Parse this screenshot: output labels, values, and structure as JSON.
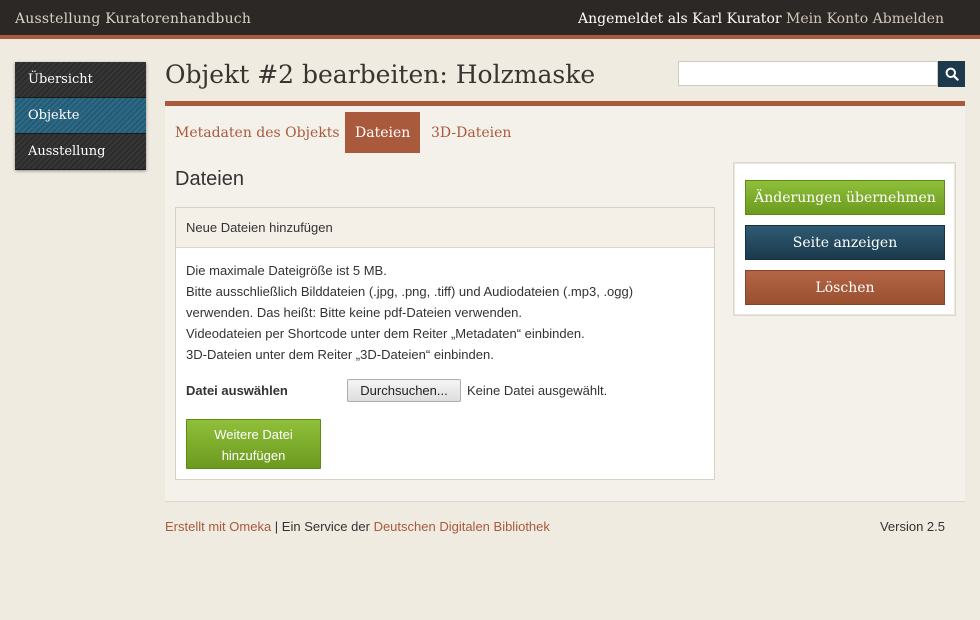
{
  "app": {
    "site_title": "Ausstellung Kuratorenhandbuch",
    "logged_in_text": "Angemeldet als Karl Kurator",
    "account_link": "Mein Konto",
    "logout_link": "Abmelden"
  },
  "sidebar": {
    "items": [
      {
        "label": "Übersicht",
        "active": false
      },
      {
        "label": "Objekte",
        "active": true
      },
      {
        "label": "Ausstellung",
        "active": false
      }
    ]
  },
  "page": {
    "title": "Objekt #2 bearbeiten: Holzmaske"
  },
  "search": {
    "value": "",
    "placeholder": "",
    "icon": "search-icon"
  },
  "tabs": [
    {
      "label": "Metadaten des Objekts",
      "active": false
    },
    {
      "label": "Dateien",
      "active": true
    },
    {
      "label": "3D-Dateien",
      "active": false
    }
  ],
  "files_section": {
    "title": "Dateien",
    "box_header": "Neue Dateien hinzufügen",
    "info_lines": [
      "Die maximale Dateigröße ist 5 MB.",
      "Bitte ausschließlich Bilddateien (.jpg, .png, .tiff) und Audiodateien (.mp3, .ogg)",
      "verwenden. Das heißt: Bitte keine pdf-Dateien verwenden.",
      "Videodateien per Shortcode unter dem Reiter „Metadaten“ einbinden.",
      "3D-Dateien unter dem Reiter „3D-Dateien“ einbinden."
    ],
    "file_label": "Datei auswählen",
    "browse_button": "Durchsuchen...",
    "file_status": "Keine Datei ausgewählt.",
    "add_more_line1": "Weitere Datei",
    "add_more_line2": "hinzufügen"
  },
  "actions": {
    "save": "Änderungen übernehmen",
    "view": "Seite anzeigen",
    "delete": "Löschen"
  },
  "footer": {
    "created_with": "Erstellt mit Omeka",
    "separator": " | Ein Service der ",
    "ddb_link": "Deutschen Digitalen Bibliothek",
    "version": "Version 2.5"
  },
  "colors": {
    "accent": "#a95a3d",
    "topbar": "#2c2825",
    "green": "#7aa82a",
    "navy": "#1d3a4c"
  }
}
